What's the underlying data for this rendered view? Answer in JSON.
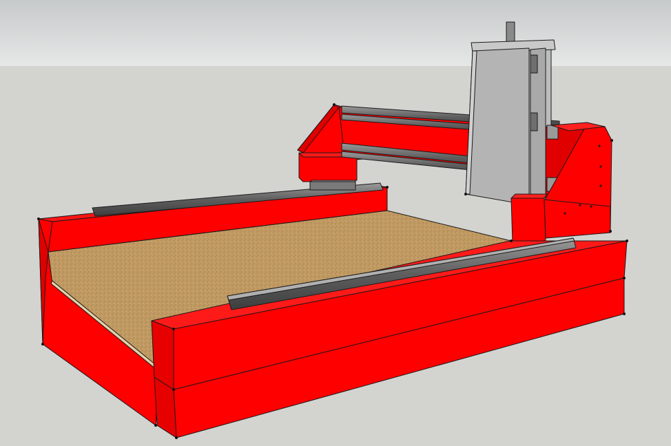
{
  "scene": {
    "subject": "cnc-router-3d-model",
    "colors": {
      "sky_top": "#c7cacb",
      "sky_bottom": "#e6e7e7",
      "ground": "#d3d3d0",
      "frame_red": "#ff0000",
      "frame_red_dark": "#d90000",
      "frame_red_shadow": "#b80000",
      "bed_wood": "#c09a62",
      "rail_gray": "#6e6e6e",
      "rail_dark": "#4a4a4a",
      "carriage_gray": "#b7b7b7",
      "carriage_light": "#cfcfcf",
      "edge": "#1a1a1a"
    }
  }
}
